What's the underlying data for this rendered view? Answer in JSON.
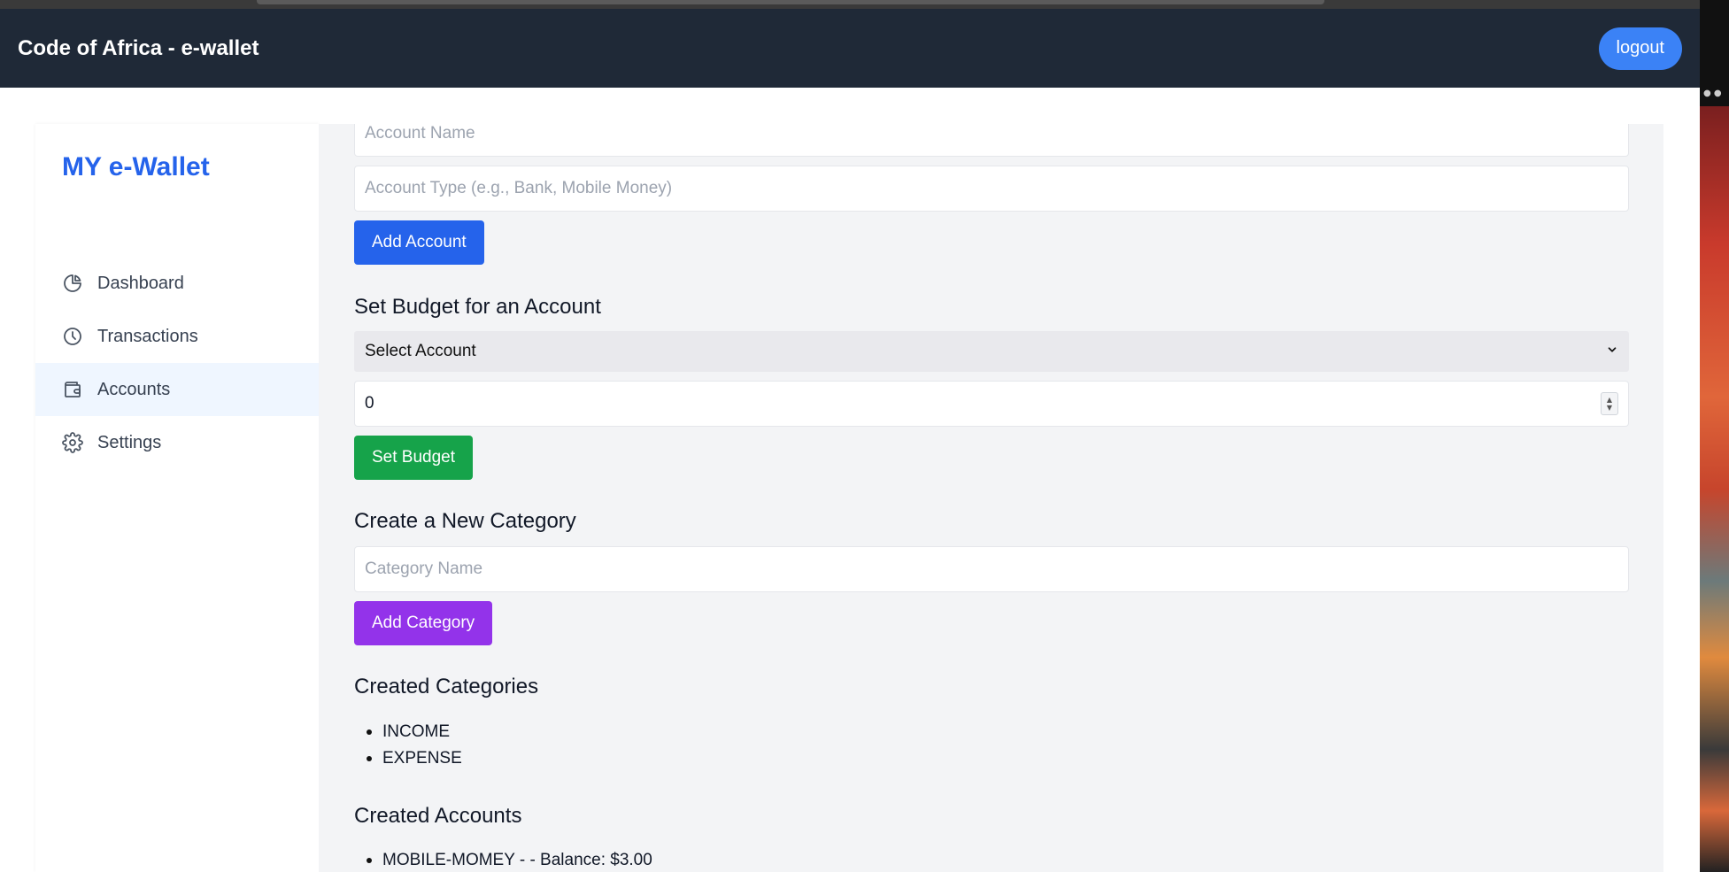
{
  "header": {
    "title": "Code of Africa - e-wallet",
    "logout_label": "logout"
  },
  "sidebar": {
    "brand": "MY e-Wallet",
    "items": [
      {
        "label": "Dashboard",
        "icon": "pie-chart-icon",
        "active": false
      },
      {
        "label": "Transactions",
        "icon": "clock-icon",
        "active": false
      },
      {
        "label": "Accounts",
        "icon": "wallet-icon",
        "active": true
      },
      {
        "label": "Settings",
        "icon": "gear-icon",
        "active": false
      }
    ]
  },
  "add_account": {
    "name_placeholder": "Account Name",
    "type_placeholder": "Account Type (e.g., Bank, Mobile Money)",
    "button_label": "Add Account"
  },
  "budget": {
    "title": "Set Budget for an Account",
    "select_value": "Select Account",
    "amount_value": "0",
    "button_label": "Set Budget"
  },
  "category": {
    "title": "Create a New Category",
    "name_placeholder": "Category Name",
    "button_label": "Add Category"
  },
  "created_categories": {
    "title": "Created Categories",
    "items": [
      "INCOME",
      "EXPENSE"
    ]
  },
  "created_accounts": {
    "title": "Created Accounts",
    "items": [
      "MOBILE-MOMEY - - Balance: $3.00"
    ]
  },
  "colors": {
    "header_bg": "#1f2937",
    "accent_blue": "#2563eb",
    "logout_blue": "#3b82f6",
    "budget_green": "#16a34a",
    "category_purple": "#9333ea",
    "active_nav_bg": "#eff6ff",
    "main_bg": "#f3f4f6"
  }
}
